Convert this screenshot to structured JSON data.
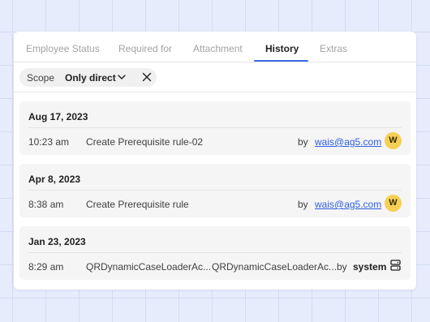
{
  "tabs": [
    {
      "label": "Employee Status",
      "active": false
    },
    {
      "label": "Required for",
      "active": false
    },
    {
      "label": "Attachment",
      "active": false
    },
    {
      "label": "History",
      "active": true
    },
    {
      "label": "Extras",
      "active": false
    }
  ],
  "filter": {
    "label": "Scope",
    "value": "Only direct",
    "dropdown_icon": "chevron-down-icon",
    "clear_icon": "close-icon"
  },
  "history": [
    {
      "date": "Aug 17, 2023",
      "time": "10:23 am",
      "action": "Create Prerequisite rule-02",
      "by": "by",
      "user": "wais@ag5.com",
      "avatar": "W"
    },
    {
      "date": "Apr 8, 2023",
      "time": "8:38 am",
      "action": "Create Prerequisite rule",
      "by": "by",
      "user": "wais@ag5.com",
      "avatar": "W"
    },
    {
      "date": "Jan 23, 2023",
      "time": "8:29 am",
      "action": "QRDynamicCaseLoaderAc...",
      "action_detail": "QRDynamicCaseLoaderAc...",
      "by": "by",
      "user": "system",
      "user_icon": "server-icon"
    }
  ],
  "colors": {
    "accent": "#3d6ae6",
    "link": "#2f5ee0",
    "avatar_bg": "#f6cf55",
    "background": "#e6ecfb"
  }
}
